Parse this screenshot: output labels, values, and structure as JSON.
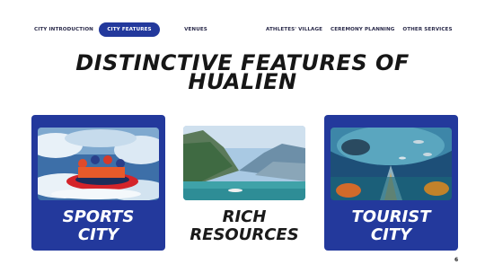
{
  "nav": {
    "items": [
      {
        "label": "CITY INTRODUCTION"
      },
      {
        "label": "CITY FEATURES"
      },
      {
        "label": "VENUES"
      },
      {
        "label": "ATHLETES' VILLAGE"
      },
      {
        "label": "CEREMONY PLANNING"
      },
      {
        "label": "OTHER SERVICES"
      }
    ],
    "active_index": 1,
    "active_color": "#23399c"
  },
  "title": {
    "line1": "DISTINCTIVE FEATURES OF",
    "line2": "HUALIEN"
  },
  "cards": [
    {
      "line1": "SPORTS",
      "line2": "CITY",
      "image": "white-water-rafting-photo"
    },
    {
      "line1": "RICH",
      "line2": "RESOURCES",
      "image": "gorge-river-photo"
    },
    {
      "line1": "TOURIST",
      "line2": "CITY",
      "image": "aquarium-tunnel-photo"
    }
  ],
  "card_color": "#23399c",
  "page_number": "6"
}
